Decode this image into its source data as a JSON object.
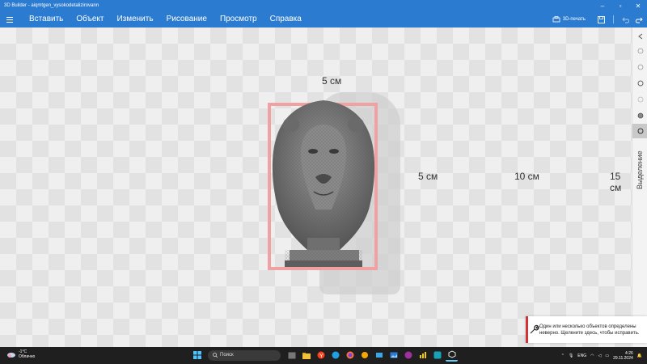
{
  "window": {
    "title": "3D Builder - aiqmtgen_vysokodetalizirovann"
  },
  "menu": {
    "items": [
      "Вставить",
      "Объект",
      "Изменить",
      "Рисование",
      "Просмотр",
      "Справка"
    ],
    "print3d_label": "3D-печать"
  },
  "canvas": {
    "top_dimension": "5 см",
    "ruler_labels": [
      "5 см",
      "10 см",
      "15 см"
    ]
  },
  "toolpanel": {
    "vertical_label": "Выделение"
  },
  "notification": {
    "message": "Один или несколько объектов определены неверно. Щелкните здесь, чтобы исправить."
  },
  "taskbar": {
    "weather_temp": "-1°C",
    "weather_desc": "Облачно",
    "search_placeholder": "Поиск",
    "lang": "ENG",
    "time": "4:26",
    "date": "29.11.2024"
  },
  "colors": {
    "accent": "#2b7bd1",
    "selection": "#f0a2a2",
    "taskbar": "#1f1f1f",
    "error": "#d13438"
  }
}
